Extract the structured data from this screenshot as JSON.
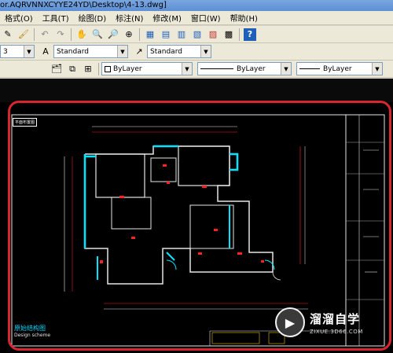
{
  "window": {
    "title": "or.AQRVNNXCYYE24YD\\Desktop\\4-13.dwg]"
  },
  "menu": {
    "items": [
      "格式(O)",
      "工具(T)",
      "绘图(D)",
      "标注(N)",
      "修改(M)",
      "窗口(W)",
      "帮助(H)"
    ]
  },
  "toolbar1": {
    "icons": [
      "pencil-icon",
      "brush-icon",
      "undo-icon",
      "redo-icon",
      "pan-icon",
      "zoom-realtime-icon",
      "zoom-window-icon",
      "zoom-previous-icon",
      "properties-icon",
      "design-center-icon",
      "tool-palettes-icon",
      "sheet-set-icon",
      "markup-icon",
      "calculator-icon",
      "help-icon"
    ]
  },
  "toolbar2": {
    "layer_value": "3",
    "text_style": "Standard",
    "dim_style": "Standard"
  },
  "toolbar3": {
    "color": "ByLayer",
    "linetype": "ByLayer",
    "lineweight": "ByLayer"
  },
  "drawing": {
    "stamp": "平面布置图",
    "design_title": "原始结构图",
    "design_sub": "Design scheme"
  },
  "watermark": {
    "name": "溜溜自学",
    "url": "ZIXUE.3D66.COM"
  },
  "colors": {
    "highlight_frame": "#d8262f",
    "wall_cyan": "#00e5ff",
    "dimension_red": "#ff2020"
  }
}
